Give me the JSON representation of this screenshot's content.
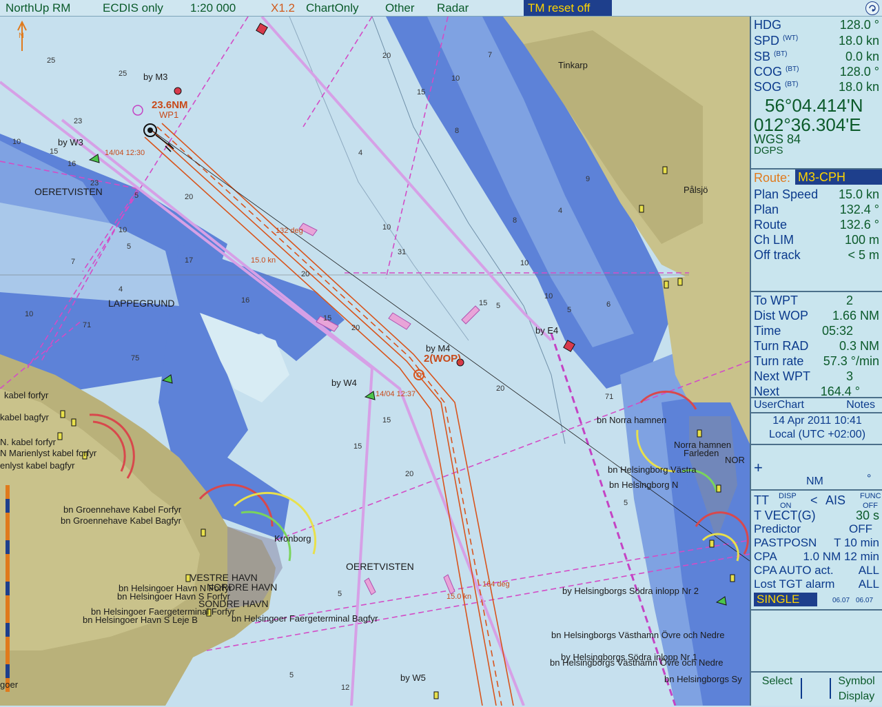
{
  "topbar": {
    "orientation": "NorthUp RM",
    "mode": "ECDIS only",
    "scale": "1:20 000",
    "zoom": "X1.2",
    "display": "ChartOnly",
    "other": "Other",
    "radar": "Radar",
    "tm_reset": "TM reset off"
  },
  "nav": {
    "hdg_label": "HDG",
    "hdg_value": "128.0 °",
    "spd_label": "SPD",
    "spd_sub": "(WT)",
    "spd_value": "18.0 kn",
    "sb_label": "SB",
    "sb_sub": "(BT)",
    "sb_value": "0.0 kn",
    "cog_label": "COG",
    "cog_sub": "(BT)",
    "cog_value": "128.0 °",
    "sog_label": "SOG",
    "sog_sub": "(BT)",
    "sog_value": "18.0 kn",
    "lat": "56°04.414'N",
    "lon": "012°36.304'E",
    "datum": "WGS 84",
    "fix": "DGPS"
  },
  "route": {
    "label": "Route:",
    "name": "M3-CPH",
    "plan_speed_label": "Plan Speed",
    "plan_speed_value": "15.0 kn",
    "plan_label": "Plan",
    "plan_value": "132.4 °",
    "route_label": "Route",
    "route_value": "132.6 °",
    "chlim_label": "Ch LIM",
    "chlim_value": "100 m",
    "offtrack_label": "Off track",
    "offtrack_value": "<    5 m"
  },
  "wpt": {
    "to_label": "To WPT",
    "to_value": "2",
    "dist_label": "Dist WOP",
    "dist_value": "1.66 NM",
    "time_label": "Time",
    "time_value": "05:32",
    "rad_label": "Turn RAD",
    "rad_value": "0.3 NM",
    "rate_label": "Turn rate",
    "rate_value": "57.3 °/min",
    "next_label": "Next WPT",
    "next_value": "3",
    "nextc_label": "Next",
    "nextc_value": "164.4 °"
  },
  "userchart": {
    "left": "UserChart",
    "right": "Notes"
  },
  "datetime": {
    "date": "14 Apr 2011 10:41",
    "zone": "Local (UTC +02:00)"
  },
  "cursor": {
    "unit": "NM",
    "deg": "°"
  },
  "ais": {
    "tt": "TT",
    "disp": "DISP",
    "on": "ON",
    "lt": "<",
    "ais_label": "AIS",
    "func": "FUNC",
    "off": "OFF",
    "tvect_label": "T VECT(G)",
    "tvect_value": "30 s",
    "pred_label": "Predictor",
    "pred_value": "OFF",
    "past_label": "PASTPOSN",
    "past_value": "T 10 min",
    "cpa_label": "CPA",
    "cpa_value": "1.0 NM 12 min",
    "cpaauto_label": "CPA AUTO act.",
    "cpaauto_value": "ALL",
    "lost_label": "Lost TGT alarm",
    "lost_value": "ALL",
    "single": "SINGLE",
    "v1": "06.07",
    "v2": "06.07"
  },
  "bottom": {
    "select": "Select",
    "symbol": "Symbol",
    "display": "Display"
  },
  "chart_labels": {
    "by_m3": "by M3",
    "wp_dist": "23.6NM",
    "wp1": "WP1",
    "by_w3": "by W3",
    "t1": "14/04 12:30",
    "oeret1": "OERETVISTEN",
    "lappegrund": "LAPPEGRUND",
    "deg132": "132 deg",
    "kn15": "15.0 kn",
    "tinkarp": "Tinkarp",
    "palsjo": "Pålsjö",
    "by_m4": "by M4",
    "wp2": "2(WOP)",
    "by_w4": "by W4",
    "t2": "14/04 12:37",
    "by_e4": "by E4",
    "kabel1": "kabel forfyr",
    "kabel2": "kabel bagfyr",
    "kabel3": "N. kabel forfyr",
    "kabel4": "N Marienlyst kabel forfyr",
    "kabel5": "enlyst kabel bagfyr",
    "groen1": "bn Groennehave Kabel Forfyr",
    "groen2": "bn Groennehave Kabel Bagfyr",
    "kronborg": "Kronborg",
    "vestre": "VESTRE HAVN",
    "nordre": "NORDRE HAVN",
    "sondre": "SONDRE HAVN",
    "hels1": "bn Helsingoer Havn N Forfyr",
    "hels2": "bn Helsingoer Havn S Forfyr",
    "hels3": "bn Helsingoer Faergeterminal Forfyr",
    "hels4": "bn Helsingoer Havn S Leje B",
    "hels5": "bn Helsingoer Faergeterminal Bagfyr",
    "oeret2": "OERETVISTEN",
    "deg164": "164 deg",
    "kn15b": "15.0 kn",
    "norra": "bn Norra hamnen",
    "norra2": "Norra hamnen",
    "farleden": "Farleden",
    "hbg1": "bn Helsingborg Västra",
    "hbg2": "bn Helsingborg N",
    "hbg3": "by Helsingborgs Södra inlopp Nr 2",
    "hbg4": "bn Helsingborgs Västhamn Övre och Nedre",
    "hbg5": "by Helsingborgs Södra inlopp Nr 1",
    "hbg6": "bn Helsingborgs Västhamn Övre och Nedre",
    "hbg7": "bn Helsingborgs Sy",
    "by_w5": "by W5",
    "goer": "goer",
    "nor": "NOR",
    "north_n": "N"
  }
}
